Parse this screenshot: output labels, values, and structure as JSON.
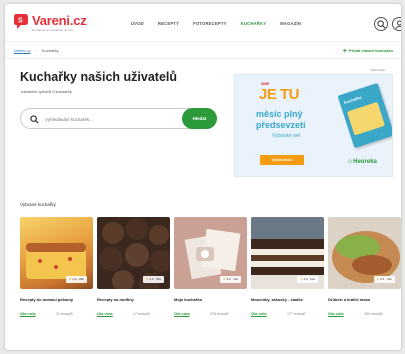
{
  "header": {
    "logo_text": "Vareni.cz",
    "logo_tagline": "Rozšiřujeme kuchařské obzory",
    "nav": [
      "ÚVOD",
      "RECEPTY",
      "FOTORECEPTY",
      "KUCHAŘKY",
      "MAGAZÍN"
    ],
    "active_nav": "KUCHAŘKY"
  },
  "breadcrumb": {
    "home": "Vaření.cz",
    "current": "Kuchařky"
  },
  "add_cookbook_label": "Přidat vlastní kuchařku",
  "page": {
    "title": "Kuchařky našich uživatelů",
    "subtitle": "uživatelé vytvořili 0 kuchařek"
  },
  "search": {
    "placeholder": "Vyhledávání kuchařek...",
    "button": "Hledat"
  },
  "ad": {
    "label": "REKLAMA",
    "prefix": "3ME",
    "headline": "JE TU",
    "line1": "měsíc plný",
    "line2": "předsevzetí",
    "sub": "Vybavte se!",
    "button": "Vybrat knihu",
    "book_title": "Kuchařka",
    "brand": "Heureka"
  },
  "featured": {
    "title": "Vybrané kuchařky",
    "cards": [
      {
        "name": "Recepty do domácí pekárny",
        "author": "Ola vola",
        "count": "31 receptů",
        "rating": "4.0",
        "votes": "88x",
        "colors": [
          "#f5c04a",
          "#c7722f"
        ]
      },
      {
        "name": "Recepty na muffiny",
        "author": "Ola vola",
        "count": "17 receptů",
        "rating": "4.2",
        "votes": "89x",
        "colors": [
          "#4a3326",
          "#7a5240"
        ]
      },
      {
        "name": "Moje kuchařka",
        "author": "Ola vola",
        "count": "378 receptů",
        "rating": "3.2",
        "votes": "10x",
        "colors": [
          "#d3a99c",
          "#b78576"
        ]
      },
      {
        "name": "Moučníky, zákusky - sladké",
        "author": "Ola vola",
        "count": "177 receptů",
        "rating": "4.0",
        "votes": "64x",
        "colors": [
          "#4e3324",
          "#efe7dc"
        ]
      },
      {
        "name": "Drůbeží a králičí maso",
        "author": "Ola vola",
        "count": "350 receptů",
        "rating": "4.1",
        "votes": "41x",
        "colors": [
          "#8ab04a",
          "#c58a52"
        ]
      }
    ]
  },
  "colors": {
    "brand_red": "#e5303a",
    "accent_green": "#2a9a3b"
  },
  "icons": {
    "search": "search-icon",
    "user": "user-icon",
    "camera": "camera-icon"
  }
}
